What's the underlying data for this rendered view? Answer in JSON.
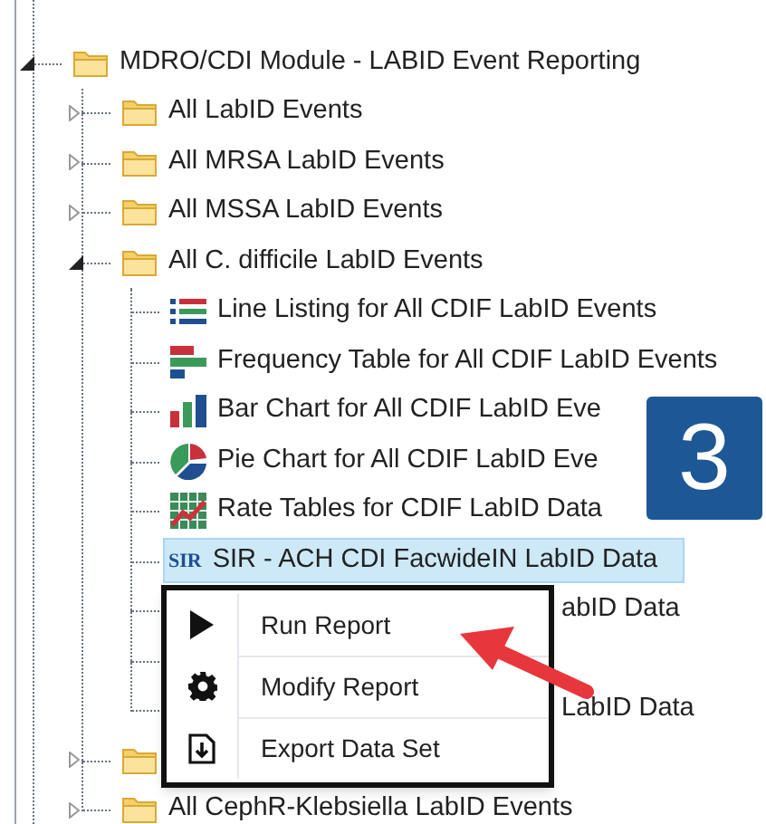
{
  "tree": [
    {
      "kind": "folder",
      "label": "MDRO/CDI Module - LABID Event Reporting",
      "expanded": true,
      "selected": false,
      "children": [
        {
          "kind": "folder",
          "label": "All LabID Events",
          "expanded": false,
          "selected": false
        },
        {
          "kind": "folder",
          "label": "All MRSA LabID Events",
          "expanded": false,
          "selected": false
        },
        {
          "kind": "folder",
          "label": "All MSSA LabID Events",
          "expanded": false,
          "selected": false
        },
        {
          "kind": "folder",
          "label": "All C. difficile LabID Events",
          "expanded": true,
          "selected": false,
          "children": [
            {
              "kind": "list",
              "label": "Line Listing for All CDIF LabID Events",
              "selected": false
            },
            {
              "kind": "frequency",
              "label": "Frequency Table for All CDIF LabID Events",
              "selected": false
            },
            {
              "kind": "bar",
              "label": "Bar Chart for All CDIF LabID Eve",
              "selected": false
            },
            {
              "kind": "pie",
              "label": "Pie Chart for All CDIF LabID Eve",
              "selected": false
            },
            {
              "kind": "rate",
              "label": "Rate Tables for CDIF LabID Data",
              "selected": false
            },
            {
              "kind": "sir",
              "badge": "SIR",
              "label": "SIR - ACH CDI FacwideIN LabID Data",
              "selected": true
            },
            {
              "kind": "covered",
              "label": "abID Data",
              "selected": false
            },
            {
              "kind": "covered",
              "selected": false
            },
            {
              "kind": "covered",
              "label": "LabID Data",
              "selected": false
            }
          ]
        },
        {
          "kind": "folder",
          "expanded": false,
          "selected": false
        },
        {
          "kind": "folder",
          "label": "All CephR-Klebsiella LabID Events",
          "expanded": false,
          "selected": false
        }
      ]
    }
  ],
  "context_menu": [
    {
      "kind": "run",
      "label": "Run Report"
    },
    {
      "kind": "modify",
      "label": "Modify Report"
    },
    {
      "kind": "export",
      "label": "Export Data Set"
    }
  ],
  "step_badge": "3"
}
